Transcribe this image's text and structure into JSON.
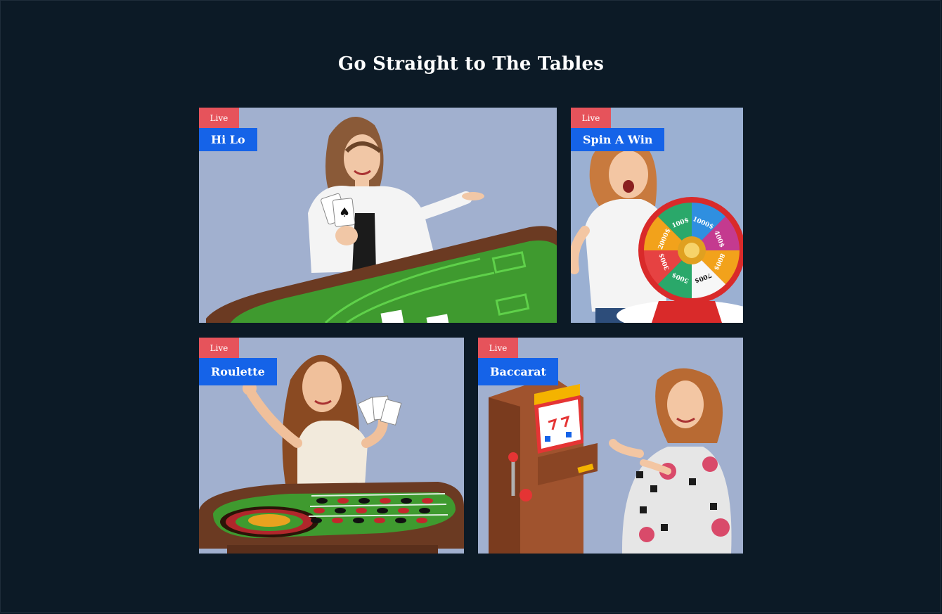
{
  "section": {
    "title": "Go Straight to The Tables"
  },
  "games": [
    {
      "badge": "Live",
      "name": "Hi Lo"
    },
    {
      "badge": "Live",
      "name": "Spin A Win"
    },
    {
      "badge": "Live",
      "name": "Roulette"
    },
    {
      "badge": "Live",
      "name": "Baccarat"
    }
  ],
  "wheel": {
    "segments": [
      "1000$",
      "400$",
      "800$",
      "700$",
      "500$",
      "300$",
      "2000$",
      "100$"
    ]
  },
  "colors": {
    "page_background": "#0c1a26",
    "card_background": "#a1b0cf",
    "live_badge": "#e6535b",
    "title_tag": "#1563e8",
    "felt_green": "#3f9a2f",
    "table_wood": "#6b3a22"
  }
}
